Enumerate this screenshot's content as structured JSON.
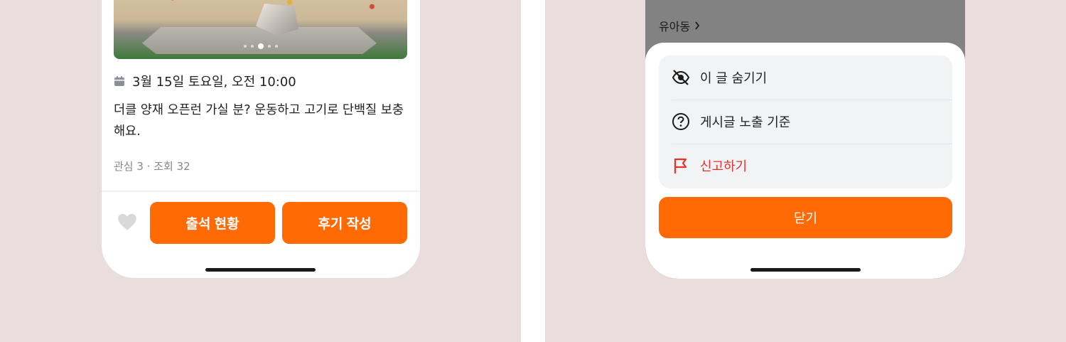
{
  "left_screen": {
    "datetime": "3월 15일 토요일, 오전 10:00",
    "post_body": "더클 양재 오픈런 가실 분? 운동하고 고기로 단백질 보충해요.",
    "stats": "관심 3 · 조회 32",
    "buttons": {
      "attendance": "출석 현황",
      "review": "후기 작성"
    },
    "icons": [
      "calendar-icon",
      "heart-icon"
    ],
    "accent_color": "#ff6a05"
  },
  "right_screen": {
    "breadcrumb": "유아동",
    "menu": [
      {
        "label": "이 글 숨기기",
        "icon": "eye-off-icon"
      },
      {
        "label": "게시글 노출 기준",
        "icon": "question-circle-icon"
      },
      {
        "label": "신고하기",
        "icon": "flag-icon",
        "color": "#e5322d"
      }
    ],
    "close_label": "닫기"
  }
}
